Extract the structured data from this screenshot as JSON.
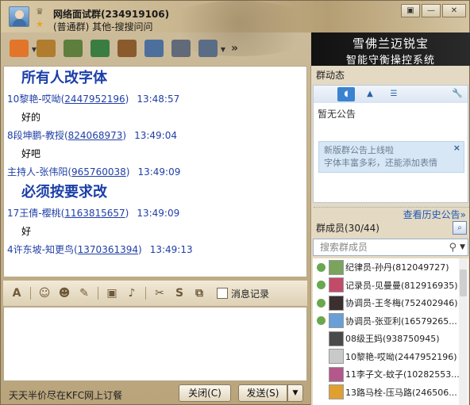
{
  "window": {
    "title": "网络面试群(234919106)",
    "subtitle": "(普通群) 其他-搜搜问问",
    "controls": [
      "▣",
      "—",
      "✕"
    ]
  },
  "toolbar": {
    "items": [
      {
        "name": "qzone-home-icon",
        "color": "#e2752a",
        "dropdown": true
      },
      {
        "name": "group-share-icon",
        "color": "#b07c2e",
        "dropdown": false
      },
      {
        "name": "group-album-icon",
        "color": "#5d7e3c",
        "dropdown": false
      },
      {
        "name": "group-video-icon",
        "color": "#3a7d43",
        "dropdown": false
      },
      {
        "name": "tea-cup-icon",
        "color": "#8a5a2c",
        "dropdown": false
      },
      {
        "name": "group-notice-icon",
        "color": "#4d6f9c",
        "dropdown": false
      },
      {
        "name": "voice-mic-icon",
        "color": "#606a78",
        "dropdown": false
      },
      {
        "name": "settings-gear-icon",
        "color": "#5b6c85",
        "dropdown": true
      }
    ],
    "more": "»"
  },
  "ad": {
    "line1": "雪佛兰迈锐宝",
    "line2": "智能守衡操控系统"
  },
  "chat": {
    "messages": [
      {
        "type": "big",
        "text": "所有人改字体"
      },
      {
        "type": "hdr",
        "sender": "10黎艳-哎呦",
        "uid": "2447952196",
        "time": "13:48:57"
      },
      {
        "type": "msg",
        "text": "好的"
      },
      {
        "type": "hdr",
        "sender": "8段坤鹏-教授",
        "uid": "824068973",
        "time": "13:49:04"
      },
      {
        "type": "msg",
        "text": "好吧"
      },
      {
        "type": "hdr",
        "sender": "主持人-张伟阳",
        "uid": "965760038",
        "time": "13:49:09"
      },
      {
        "type": "big",
        "text": "必须按要求改"
      },
      {
        "type": "hdr",
        "sender": "17王倩-樱桃",
        "uid": "1163815657",
        "time": "13:49:09"
      },
      {
        "type": "msg",
        "text": "好"
      },
      {
        "type": "hdr",
        "sender": "4许东坡-知更鸟",
        "uid": "1370361394",
        "time": "13:49:13"
      }
    ]
  },
  "format_bar": {
    "items": [
      {
        "name": "font-icon",
        "glyph": "A"
      },
      {
        "name": "emoji-icon",
        "glyph": "☺"
      },
      {
        "name": "magic-emoji-icon",
        "glyph": "☻"
      },
      {
        "name": "doodle-icon",
        "glyph": "✎"
      },
      {
        "name": "image-icon",
        "glyph": "▣"
      },
      {
        "name": "music-icon",
        "glyph": "♪"
      },
      {
        "name": "screenshot-scissors-icon",
        "glyph": "✂"
      },
      {
        "name": "sogou-icon",
        "glyph": "S"
      },
      {
        "name": "quick-reply-icon",
        "glyph": "⧉"
      }
    ],
    "message_record_label": "消息记录"
  },
  "bottom": {
    "ad_text": "天天半价尽在KFC网上订餐",
    "close_label": "关闭(C)",
    "send_label": "发送(S)",
    "send_dd": "▼"
  },
  "right_panel": {
    "bulletin_title": "群动态",
    "no_notice": "暂无公告",
    "notice_line1": "新版群公告上线啦",
    "notice_line2": "字体丰富多彩，还能添加表情",
    "notice_close": "×",
    "history_link": "查看历史公告»",
    "members_title": "群成员(30/44)",
    "search_placeholder": "搜索群成员",
    "members": [
      {
        "name": "纪律员-孙丹(812049727)",
        "role_color": "#6aa84f",
        "avatar_color": "#7aa35c"
      },
      {
        "name": "记录员-见曼曼(812916935)",
        "role_color": "#6aa84f",
        "avatar_color": "#c24b6a"
      },
      {
        "name": "协调员-王冬梅(752402946)",
        "role_color": "#6aa84f",
        "avatar_color": "#3b2f2f"
      },
      {
        "name": "协调员-张亚利(16579265...",
        "role_color": "#6aa84f",
        "avatar_color": "#6a9ed6"
      },
      {
        "name": "08级王妈(938750945)",
        "role_color": "",
        "avatar_color": "#4a4a4a"
      },
      {
        "name": "10黎艳-哎呦(2447952196)",
        "role_color": "",
        "avatar_color": "#c9c9c9"
      },
      {
        "name": "11李子文-蚊子(10282553...",
        "role_color": "",
        "avatar_color": "#b4578a"
      },
      {
        "name": "13路马栓-压马路(246506...",
        "role_color": "",
        "avatar_color": "#e0a030"
      }
    ]
  }
}
